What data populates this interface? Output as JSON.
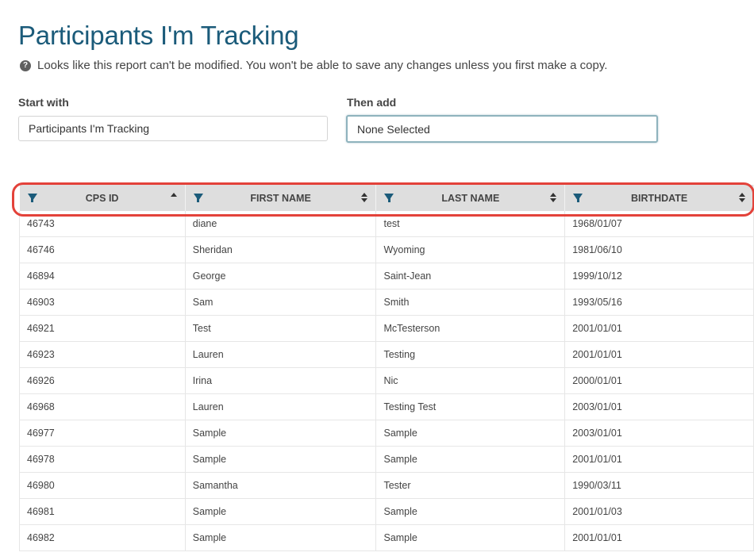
{
  "page": {
    "title": "Participants I'm Tracking",
    "notice_icon": "?",
    "notice": "Looks like this report can't be modified. You won't be able to save any changes unless you first make a copy."
  },
  "start_with": {
    "label": "Start with",
    "value": "Participants I'm Tracking"
  },
  "then_add": {
    "label": "Then add",
    "value": "None Selected"
  },
  "colors": {
    "title": "#1b5b7a",
    "highlight": "#e3423a",
    "header_bg": "#dedede"
  },
  "table": {
    "columns": [
      {
        "label": "CPS ID",
        "sort": "ascending",
        "icon": "filter-icon"
      },
      {
        "label": "FIRST NAME",
        "sort": "sortable",
        "icon": "filter-icon"
      },
      {
        "label": "LAST NAME",
        "sort": "sortable",
        "icon": "filter-icon"
      },
      {
        "label": "BIRTHDATE",
        "sort": "sortable",
        "icon": "filter-icon"
      }
    ],
    "rows": [
      [
        "46743",
        "diane",
        "test",
        "1968/01/07"
      ],
      [
        "46746",
        "Sheridan",
        "Wyoming",
        "1981/06/10"
      ],
      [
        "46894",
        "George",
        "Saint-Jean",
        "1999/10/12"
      ],
      [
        "46903",
        "Sam",
        "Smith",
        "1993/05/16"
      ],
      [
        "46921",
        "Test",
        "McTesterson",
        "2001/01/01"
      ],
      [
        "46923",
        "Lauren",
        "Testing",
        "2001/01/01"
      ],
      [
        "46926",
        "Irina",
        "Nic",
        "2000/01/01"
      ],
      [
        "46968",
        "Lauren",
        "Testing Test",
        "2003/01/01"
      ],
      [
        "46977",
        "Sample",
        "Sample",
        "2003/01/01"
      ],
      [
        "46978",
        "Sample",
        "Sample",
        "2001/01/01"
      ],
      [
        "46980",
        "Samantha",
        "Tester",
        "1990/03/11"
      ],
      [
        "46981",
        "Sample",
        "Sample",
        "2001/01/03"
      ],
      [
        "46982",
        "Sample",
        "Sample",
        "2001/01/01"
      ]
    ]
  }
}
